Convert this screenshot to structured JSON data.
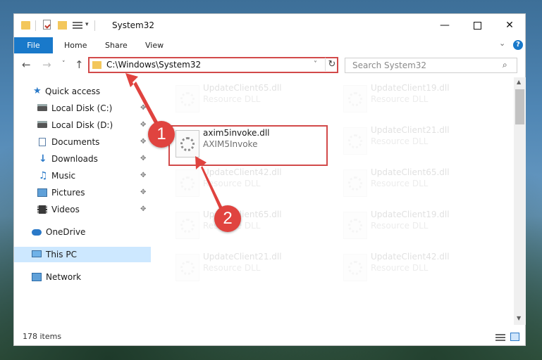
{
  "window": {
    "title": "System32",
    "controls": {
      "minimize": "—",
      "close": "✕"
    }
  },
  "ribbon": {
    "tabs": [
      "File",
      "Home",
      "Share",
      "View"
    ],
    "expand_glyph": "⌄",
    "help_glyph": "?"
  },
  "navigation": {
    "back_glyph": "←",
    "forward_glyph": "→",
    "recent_glyph": "˅",
    "up_glyph": "↑",
    "address": "C:\\Windows\\System32",
    "address_dropdown_glyph": "˅",
    "refresh_glyph": "↻",
    "search_placeholder": "Search System32",
    "search_glyph": "⌕"
  },
  "sidebar": {
    "items": [
      {
        "label": "Quick access",
        "icon": "star-icon",
        "pinned": false
      },
      {
        "label": "Local Disk (C:)",
        "icon": "drive-icon",
        "pinned": true
      },
      {
        "label": "Local Disk (D:)",
        "icon": "drive-icon",
        "pinned": true
      },
      {
        "label": "Documents",
        "icon": "documents-icon",
        "pinned": true
      },
      {
        "label": "Downloads",
        "icon": "download-icon",
        "pinned": true
      },
      {
        "label": "Music",
        "icon": "music-icon",
        "pinned": true
      },
      {
        "label": "Pictures",
        "icon": "pictures-icon",
        "pinned": true
      },
      {
        "label": "Videos",
        "icon": "videos-icon",
        "pinned": true
      },
      {
        "label": "OneDrive",
        "icon": "onedrive-icon",
        "pinned": false
      },
      {
        "label": "This PC",
        "icon": "this-pc-icon",
        "pinned": false,
        "selected": true
      },
      {
        "label": "Network",
        "icon": "network-icon",
        "pinned": false
      }
    ],
    "pin_glyph": "✥"
  },
  "files": [
    {
      "name": "UpdateClient65.dll",
      "description": "Resource DLL",
      "faded": true
    },
    {
      "name": "UpdateClient19.dll",
      "description": "Resource DLL",
      "faded": true
    },
    {
      "name": "axim5invoke.dll",
      "description": "AXIM5Invoke",
      "faded": false
    },
    {
      "name": "UpdateClient21.dll",
      "description": "Resource DLL",
      "faded": true
    },
    {
      "name": "UpdateClient42.dll",
      "description": "Resource DLL",
      "faded": true
    },
    {
      "name": "UpdateClient65.dll",
      "description": "Resource DLL",
      "faded": true
    },
    {
      "name": "UpdateClient65.dll",
      "description": "Resource DLL",
      "faded": true
    },
    {
      "name": "UpdateClient19.dll",
      "description": "Resource DLL",
      "faded": true
    },
    {
      "name": "UpdateClient21.dll",
      "description": "Resource DLL",
      "faded": true
    },
    {
      "name": "UpdateClient42.dll",
      "description": "Resource DLL",
      "faded": true
    }
  ],
  "scrollbar": {
    "up_glyph": "▲",
    "down_glyph": "▼"
  },
  "status": {
    "item_count": "178 items"
  },
  "annotations": {
    "step_1": "1",
    "step_2": "2"
  },
  "colors": {
    "accent": "#1979ca",
    "highlight_red": "#d24a4a",
    "badge_red": "#e0433f",
    "selection": "#cde8ff"
  }
}
